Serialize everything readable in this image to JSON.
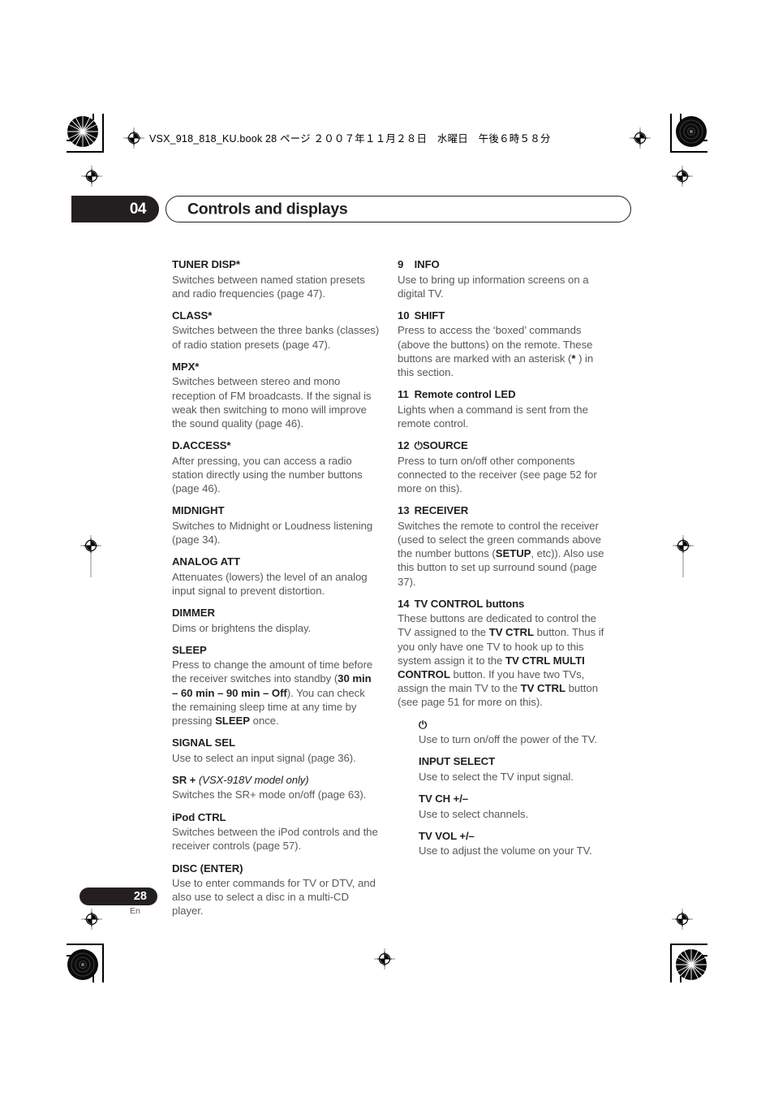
{
  "header": {
    "file_line": "VSX_918_818_KU.book  28 ページ  ２００７年１１月２８日　水曜日　午後６時５８分",
    "chapter_number": "04",
    "chapter_title": "Controls and displays"
  },
  "footer": {
    "page_number": "28",
    "language_code": "En"
  },
  "colors": {
    "ink": "#231f20",
    "body_text": "#58595b",
    "paper": "#ffffff"
  },
  "left_column": [
    {
      "heading": "TUNER DISP*",
      "body": "Switches between named station presets and radio frequencies (page 47)."
    },
    {
      "heading": "CLASS*",
      "body": "Switches between the three banks (classes) of radio station presets (page 47)."
    },
    {
      "heading": "MPX*",
      "body": "Switches between stereo and mono reception of FM broadcasts. If the signal is weak then switching to mono will improve the sound quality (page 46)."
    },
    {
      "heading": "D.ACCESS*",
      "body": "After pressing, you can access a radio station directly using the number buttons (page 46)."
    },
    {
      "heading": "MIDNIGHT",
      "body": "Switches to Midnight or Loudness listening (page 34)."
    },
    {
      "heading": "ANALOG ATT",
      "body": "Attenuates (lowers) the level of an analog input signal to prevent distortion."
    },
    {
      "heading": "DIMMER",
      "body": "Dims or brightens the display."
    },
    {
      "heading": "SLEEP",
      "body_parts": [
        {
          "text": "Press to change the amount of time before the receiver switches into standby (",
          "bold": false
        },
        {
          "text": "30 min – 60 min – 90 min – Off",
          "bold": true
        },
        {
          "text": "). You can check the remaining sleep time at any time by pressing ",
          "bold": false
        },
        {
          "text": "SLEEP",
          "bold": true
        },
        {
          "text": " once.",
          "bold": false
        }
      ]
    },
    {
      "heading": "SIGNAL SEL",
      "body": "Use to select an input signal (page 36)."
    },
    {
      "heading": "SR +",
      "heading_italic": "(VSX-918V model only)",
      "body": "Switches the SR+ mode on/off (page 63)."
    },
    {
      "heading": "iPod CTRL",
      "body": "Switches between the iPod controls and the receiver controls (page 57)."
    },
    {
      "heading": "DISC (ENTER)",
      "body": "Use to enter commands for TV or DTV, and also use to select a disc in a multi-CD player."
    }
  ],
  "right_column": [
    {
      "number": "9",
      "heading": "INFO",
      "body": "Use to bring up information screens on a digital TV."
    },
    {
      "number": "10",
      "heading": "SHIFT",
      "body_parts": [
        {
          "text": "Press to access the ‘boxed’ commands (above the buttons) on the remote. These buttons are marked with an asterisk (",
          "bold": false
        },
        {
          "text": "*",
          "bold": true
        },
        {
          "text": " ) in this section.",
          "bold": false
        }
      ]
    },
    {
      "number": "11",
      "heading": "Remote control LED",
      "body": "Lights when a command is sent from the remote control."
    },
    {
      "number": "12",
      "heading": "⏻SOURCE",
      "body": "Press to turn on/off other components connected to the receiver (see page 52 for more on this)."
    },
    {
      "number": "13",
      "heading": "RECEIVER",
      "body_parts": [
        {
          "text": "Switches the remote to control the receiver (used to select the green commands above the number buttons (",
          "bold": false
        },
        {
          "text": "SETUP",
          "bold": true
        },
        {
          "text": ", etc)). Also use this button to set up surround sound (page 37).",
          "bold": false
        }
      ]
    },
    {
      "number": "14",
      "heading": "TV CONTROL buttons",
      "body_parts": [
        {
          "text": "These buttons are dedicated to control the TV assigned to the ",
          "bold": false
        },
        {
          "text": "TV CTRL",
          "bold": true
        },
        {
          "text": " button. Thus if you only have one TV to hook up to this system assign it to the ",
          "bold": false
        },
        {
          "text": "TV CTRL MULTI CONTROL",
          "bold": true
        },
        {
          "text": " button. If you have two TVs, assign the main TV to the ",
          "bold": false
        },
        {
          "text": "TV CTRL",
          "bold": true
        },
        {
          "text": " button (see page 51 for more on this).",
          "bold": false
        }
      ]
    }
  ],
  "tv_control_subentries": [
    {
      "heading": "⏻",
      "body": "Use to turn on/off the power of the TV."
    },
    {
      "heading": "INPUT SELECT",
      "body": "Use to select the TV input signal."
    },
    {
      "heading": "TV CH +/–",
      "body": "Use to select channels."
    },
    {
      "heading": "TV VOL +/–",
      "body": "Use to adjust the volume on your TV."
    }
  ]
}
